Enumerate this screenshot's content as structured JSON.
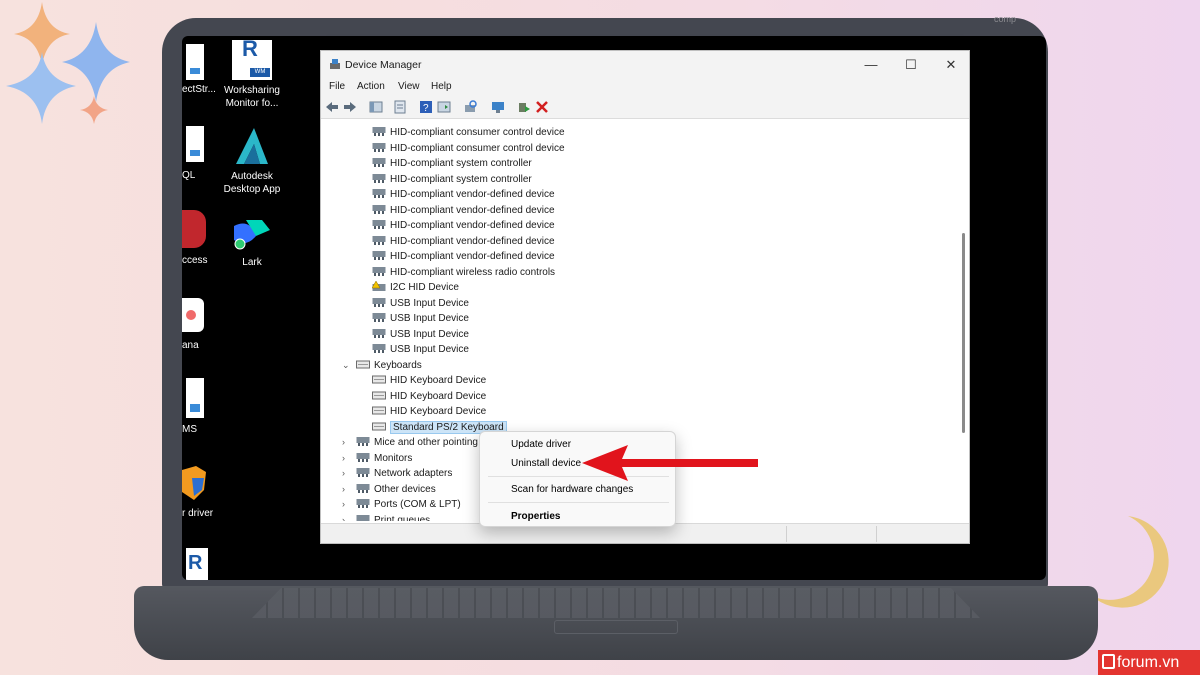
{
  "desktop": {
    "icons": [
      {
        "label": "Worksharing\nMonitor fo...",
        "icon": "revit-worksharing-icon"
      },
      {
        "label": "Autodesk\nDesktop App",
        "icon": "autodesk-icon"
      },
      {
        "label": "Lark",
        "icon": "lark-icon"
      }
    ],
    "cut_labels": [
      "ectStr...",
      "QL",
      "ccess",
      "ana",
      "MS",
      "r driver"
    ]
  },
  "window": {
    "title": "Device Manager",
    "minimize": "—",
    "maximize": "☐",
    "close": "✕",
    "menu": [
      "File",
      "Action",
      "View",
      "Help"
    ]
  },
  "tree": {
    "hid_items": [
      "HID-compliant consumer control device",
      "HID-compliant consumer control device",
      "HID-compliant system controller",
      "HID-compliant system controller",
      "HID-compliant vendor-defined device",
      "HID-compliant vendor-defined device",
      "HID-compliant vendor-defined device",
      "HID-compliant vendor-defined device",
      "HID-compliant vendor-defined device",
      "HID-compliant wireless radio controls",
      "I2C HID Device",
      "USB Input Device",
      "USB Input Device",
      "USB Input Device",
      "USB Input Device"
    ],
    "keyboards_label": "Keyboards",
    "keyboard_items": [
      "HID Keyboard Device",
      "HID Keyboard Device",
      "HID Keyboard Device",
      "Standard PS/2 Keyboard"
    ],
    "categories": [
      "Mice and other pointing",
      "Monitors",
      "Network adapters",
      "Other devices",
      "Ports (COM & LPT)",
      "Print queues"
    ]
  },
  "context_menu": {
    "update_driver": "Update driver",
    "uninstall_device": "Uninstall device",
    "scan_hardware": "Scan for hardware changes",
    "properties": "Properties"
  },
  "watermark": {
    "text": "forum.vn"
  },
  "colors": {
    "arrow": "#e1141c",
    "selection": "#cce4f7",
    "accent": "#0067c0"
  }
}
